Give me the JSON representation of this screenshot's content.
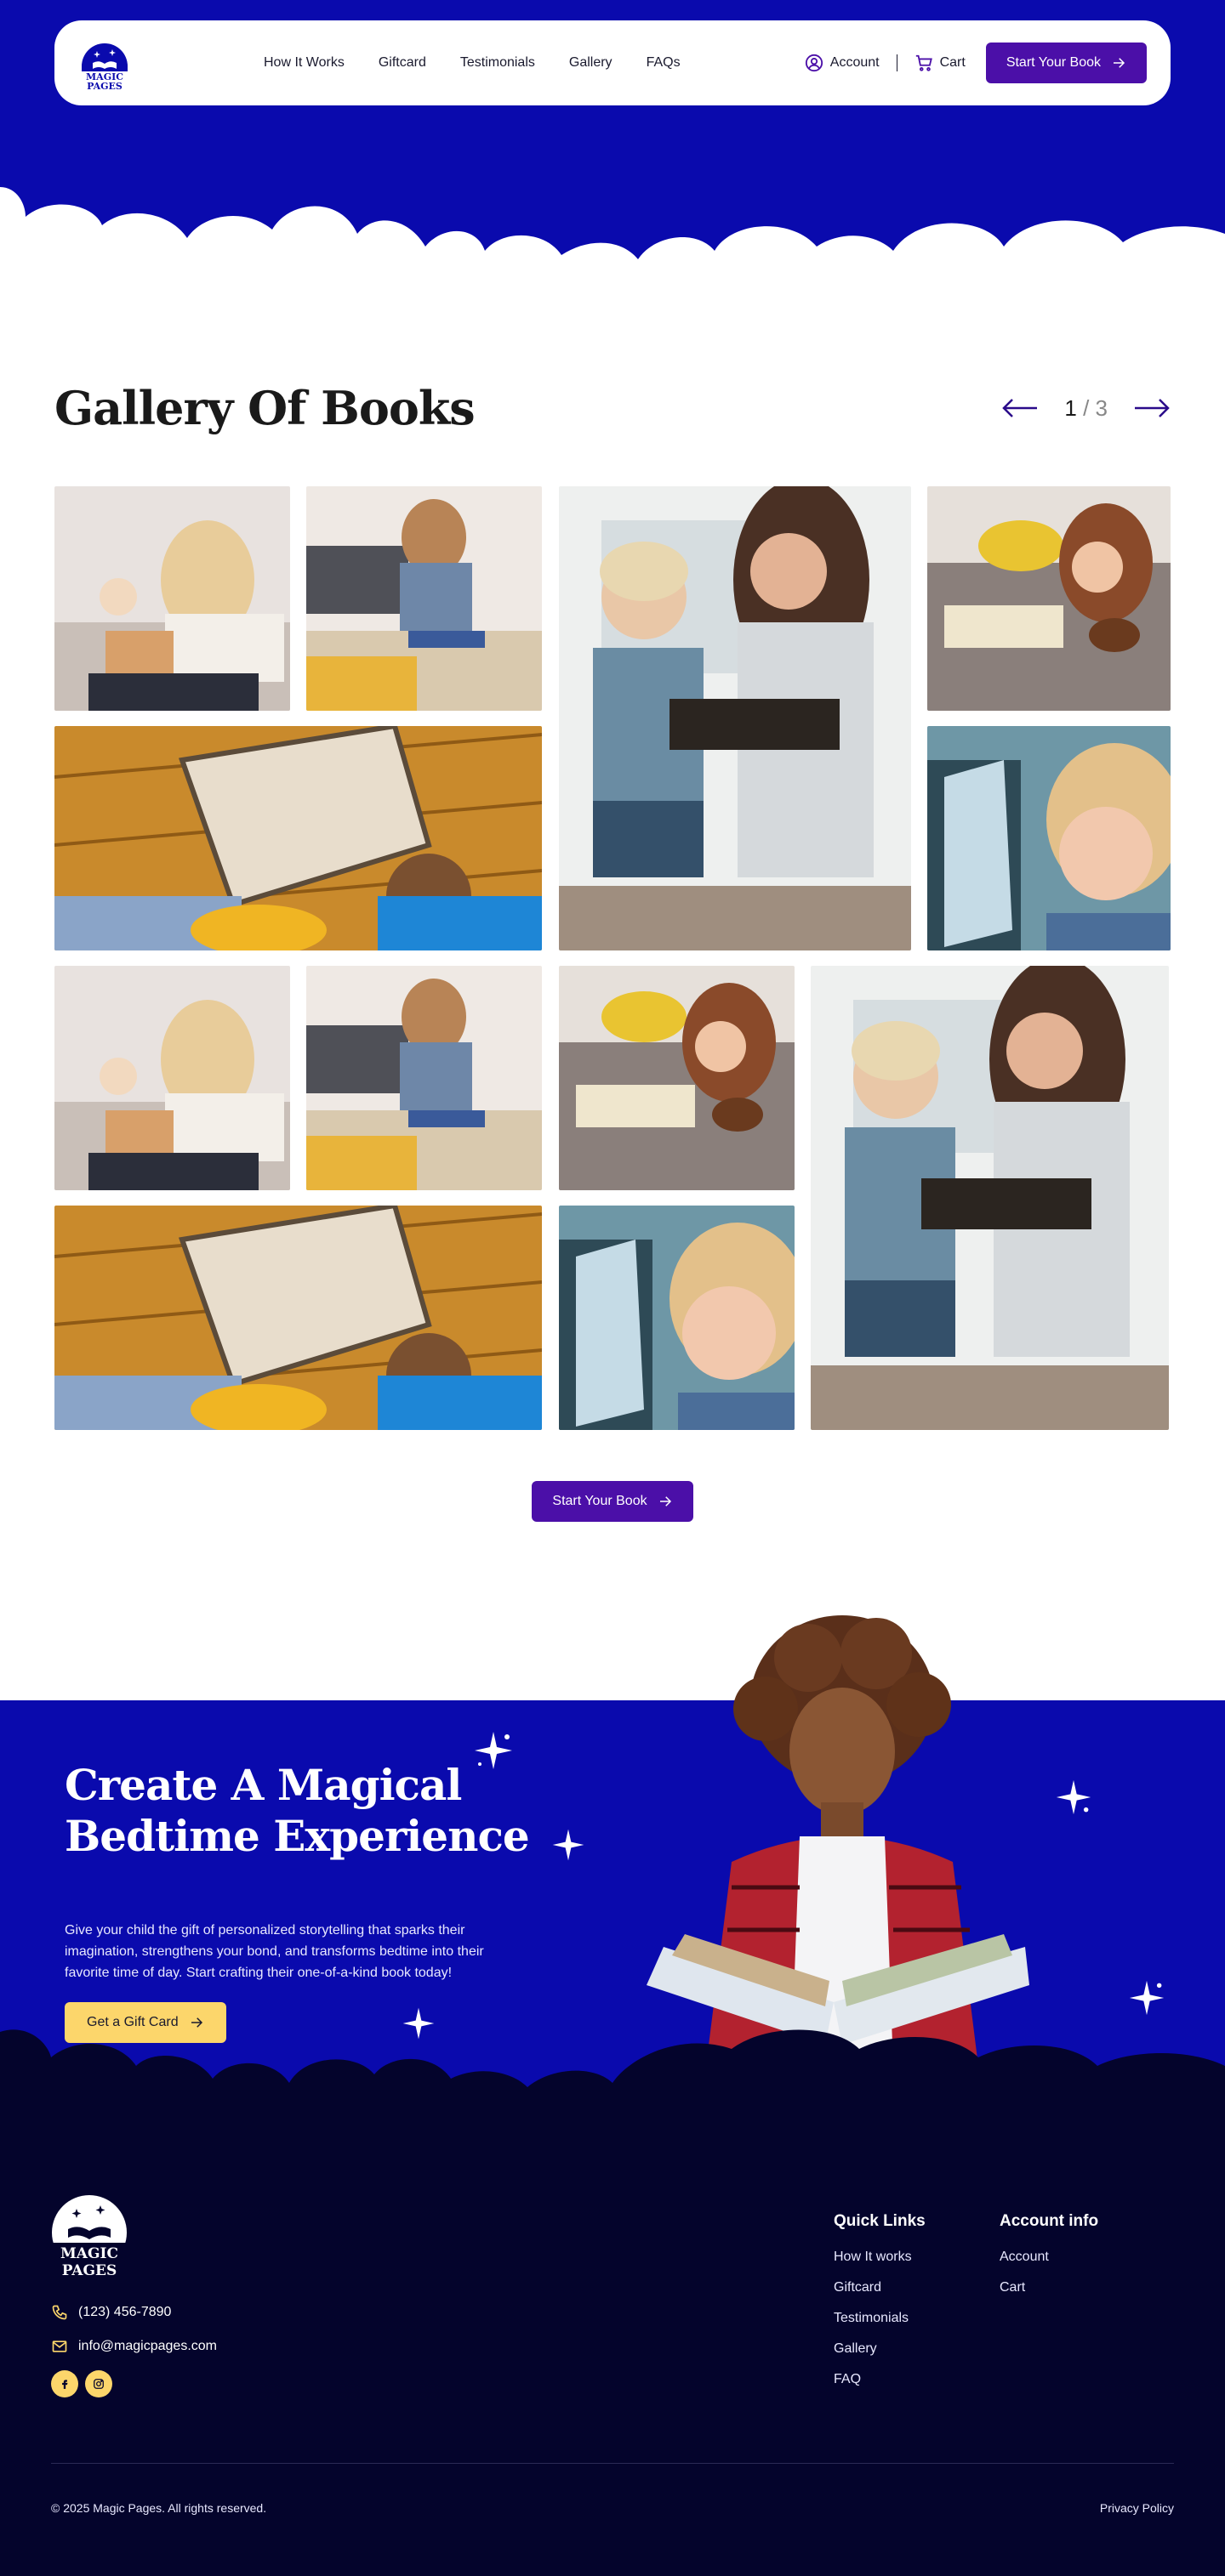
{
  "brand": {
    "logo_line1": "MAGIC",
    "logo_line2": "PAGES"
  },
  "nav": {
    "links": [
      "How It Works",
      "Giftcard",
      "Testimonials",
      "Gallery",
      "FAQs"
    ],
    "account_label": "Account",
    "cart_label": "Cart",
    "cta_label": "Start Your Book"
  },
  "gallery": {
    "title": "Gallery Of Books",
    "pager": {
      "current": "1",
      "separator": "/",
      "total": "3"
    },
    "cta_label": "Start Your Book",
    "images": [
      "mother-reading-to-daughter-on-couch",
      "girl-reading-at-table",
      "boy-and-girl-reading-book",
      "girl-reading-with-dachshund",
      "boy-and-woman-with-map-book-on-floor",
      "boy-looking-at-book-closeup",
      "mother-reading-to-daughter-on-couch",
      "girl-reading-at-table",
      "girl-reading-with-dachshund",
      "boy-and-girl-reading-book",
      "boy-and-woman-with-map-book-on-floor",
      "boy-looking-at-book-closeup"
    ]
  },
  "promo": {
    "title_line1": "Create A Magical",
    "title_line2": "Bedtime Experience",
    "text": "Give your child the gift of personalized storytelling that sparks their imagination, strengthens your bond, and transforms bedtime into their favorite time of day. Start crafting their one-of-a-kind book today!",
    "cta_label": "Get a Gift Card"
  },
  "footer": {
    "phone": "(123) 456-7890",
    "email": "info@magicpages.com",
    "socials": [
      "facebook-icon",
      "instagram-icon"
    ],
    "quick_links_title": "Quick Links",
    "quick_links": [
      "How It works",
      "Giftcard",
      "Testimonials",
      "Gallery",
      "FAQ"
    ],
    "account_title": "Account info",
    "account_links": [
      "Account",
      "Cart"
    ],
    "copyright": "© 2025 Magic Pages. All rights reserved.",
    "privacy": "Privacy Policy"
  },
  "colors": {
    "royal_blue": "#0a0aad",
    "purple": "#4b0fa8",
    "yellow": "#fcd66b",
    "navy": "#04042c"
  }
}
